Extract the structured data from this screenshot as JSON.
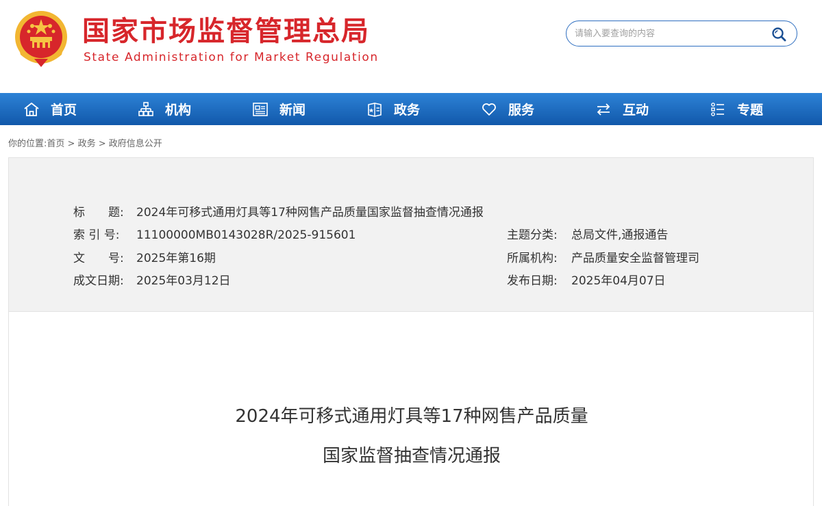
{
  "header": {
    "title_cn": "国家市场监督管理总局",
    "title_en": "State Administration for Market Regulation",
    "emblem_icon": "national-emblem-icon"
  },
  "search": {
    "placeholder": "请输入要查询的内容",
    "icon": "search-icon"
  },
  "nav": {
    "items": [
      {
        "label": "首页",
        "icon": "home-icon"
      },
      {
        "label": "机构",
        "icon": "org-chart-icon"
      },
      {
        "label": "新闻",
        "icon": "news-icon"
      },
      {
        "label": "政务",
        "icon": "government-icon"
      },
      {
        "label": "服务",
        "icon": "heart-icon"
      },
      {
        "label": "互动",
        "icon": "exchange-icon"
      },
      {
        "label": "专题",
        "icon": "list-icon"
      }
    ]
  },
  "breadcrumb": {
    "prefix": "你的位置:",
    "items": [
      "首页",
      "政务",
      "政府信息公开"
    ],
    "separator": " > "
  },
  "info": {
    "title_label": "标　　题:",
    "title_value": "2024年可移式通用灯具等17种网售产品质量国家监督抽查情况通报",
    "index_label": "索 引 号:",
    "index_value": "11100000MB0143028R/2025-915601",
    "category_label": "主题分类:",
    "category_value": "总局文件,通报通告",
    "docno_label": "文　　号:",
    "docno_value": "2025年第16期",
    "org_label": "所属机构:",
    "org_value": "产品质量安全监督管理司",
    "created_label": "成文日期:",
    "created_value": "2025年03月12日",
    "published_label": "发布日期:",
    "published_value": "2025年04月07日"
  },
  "document": {
    "title_line1": "2024年可移式通用灯具等17种网售产品质量",
    "title_line2": "国家监督抽查情况通报"
  },
  "colors": {
    "brand_red": "#d7262b",
    "nav_blue": "#1a66bb",
    "search_border": "#2f6fc0"
  }
}
